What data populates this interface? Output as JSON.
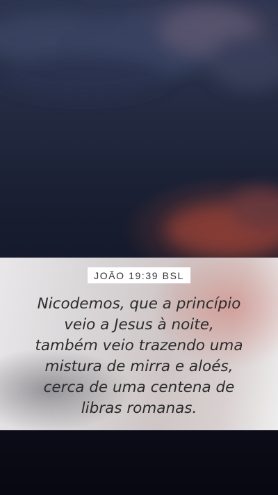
{
  "reference": "JOÃO 19:39 BSL",
  "verse": {
    "lines": [
      "Nicodemos, que a princípio",
      "veio a Jesus à noite,",
      "também veio trazendo uma",
      "mistura de mirra e aloés,",
      "cerca de uma centena de",
      "libras romanas."
    ]
  },
  "colors": {
    "sky_top": "#2d3550",
    "sky_bottom": "#0a0b17",
    "sunset_glow": "#be503c",
    "verse_text": "#2b2b2b",
    "badge_bg": "#ffffff"
  }
}
